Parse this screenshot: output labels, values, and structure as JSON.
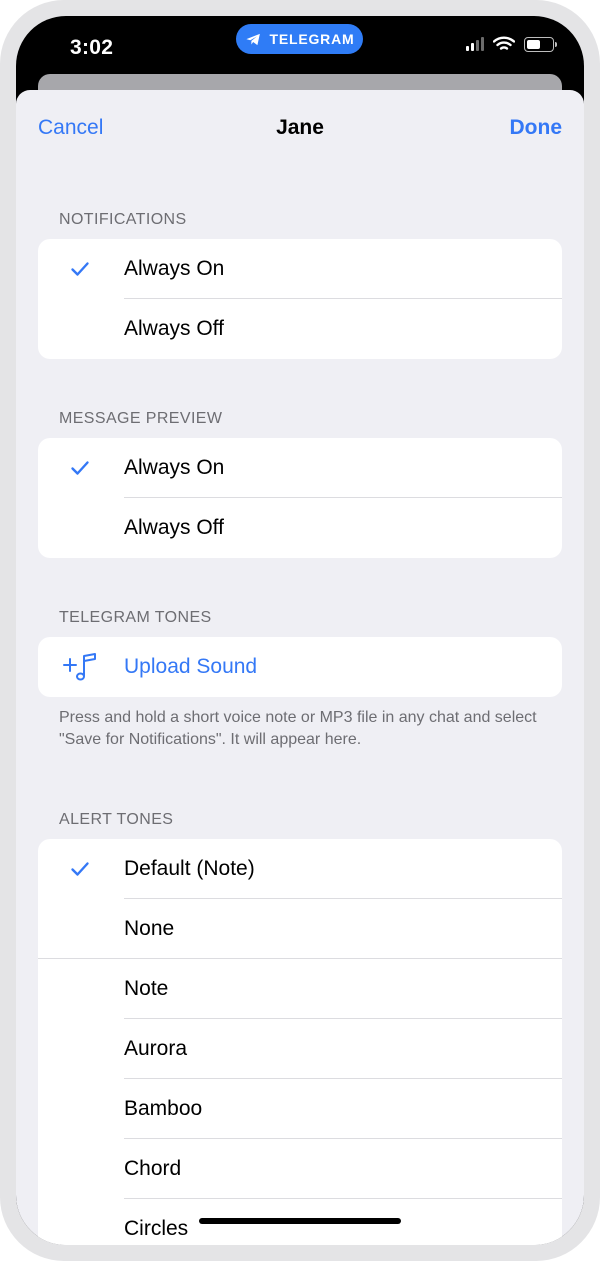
{
  "status_bar": {
    "time": "3:02",
    "pill_label": "TELEGRAM",
    "pill_color": "#2f7cf6"
  },
  "nav": {
    "cancel_label": "Cancel",
    "title": "Jane",
    "done_label": "Done",
    "accent_color": "#3478f6"
  },
  "sections": {
    "notifications": {
      "header": "NOTIFICATIONS",
      "options": [
        {
          "label": "Always On",
          "checked": true
        },
        {
          "label": "Always Off",
          "checked": false
        }
      ]
    },
    "message_preview": {
      "header": "MESSAGE PREVIEW",
      "options": [
        {
          "label": "Always On",
          "checked": true
        },
        {
          "label": "Always Off",
          "checked": false
        }
      ]
    },
    "telegram_tones": {
      "header": "TELEGRAM TONES",
      "upload_label": "Upload Sound",
      "upload_icon": "add-music-note-icon",
      "footer": "Press and hold a short voice note or MP3 file in any chat and select \"Save for Notifications\". It will appear here."
    },
    "alert_tones": {
      "header": "ALERT TONES",
      "options": [
        {
          "label": "Default (Note)",
          "checked": true
        },
        {
          "label": "None",
          "checked": false
        },
        {
          "label": "Note",
          "checked": false
        },
        {
          "label": "Aurora",
          "checked": false
        },
        {
          "label": "Bamboo",
          "checked": false
        },
        {
          "label": "Chord",
          "checked": false
        },
        {
          "label": "Circles",
          "checked": false
        }
      ]
    }
  }
}
